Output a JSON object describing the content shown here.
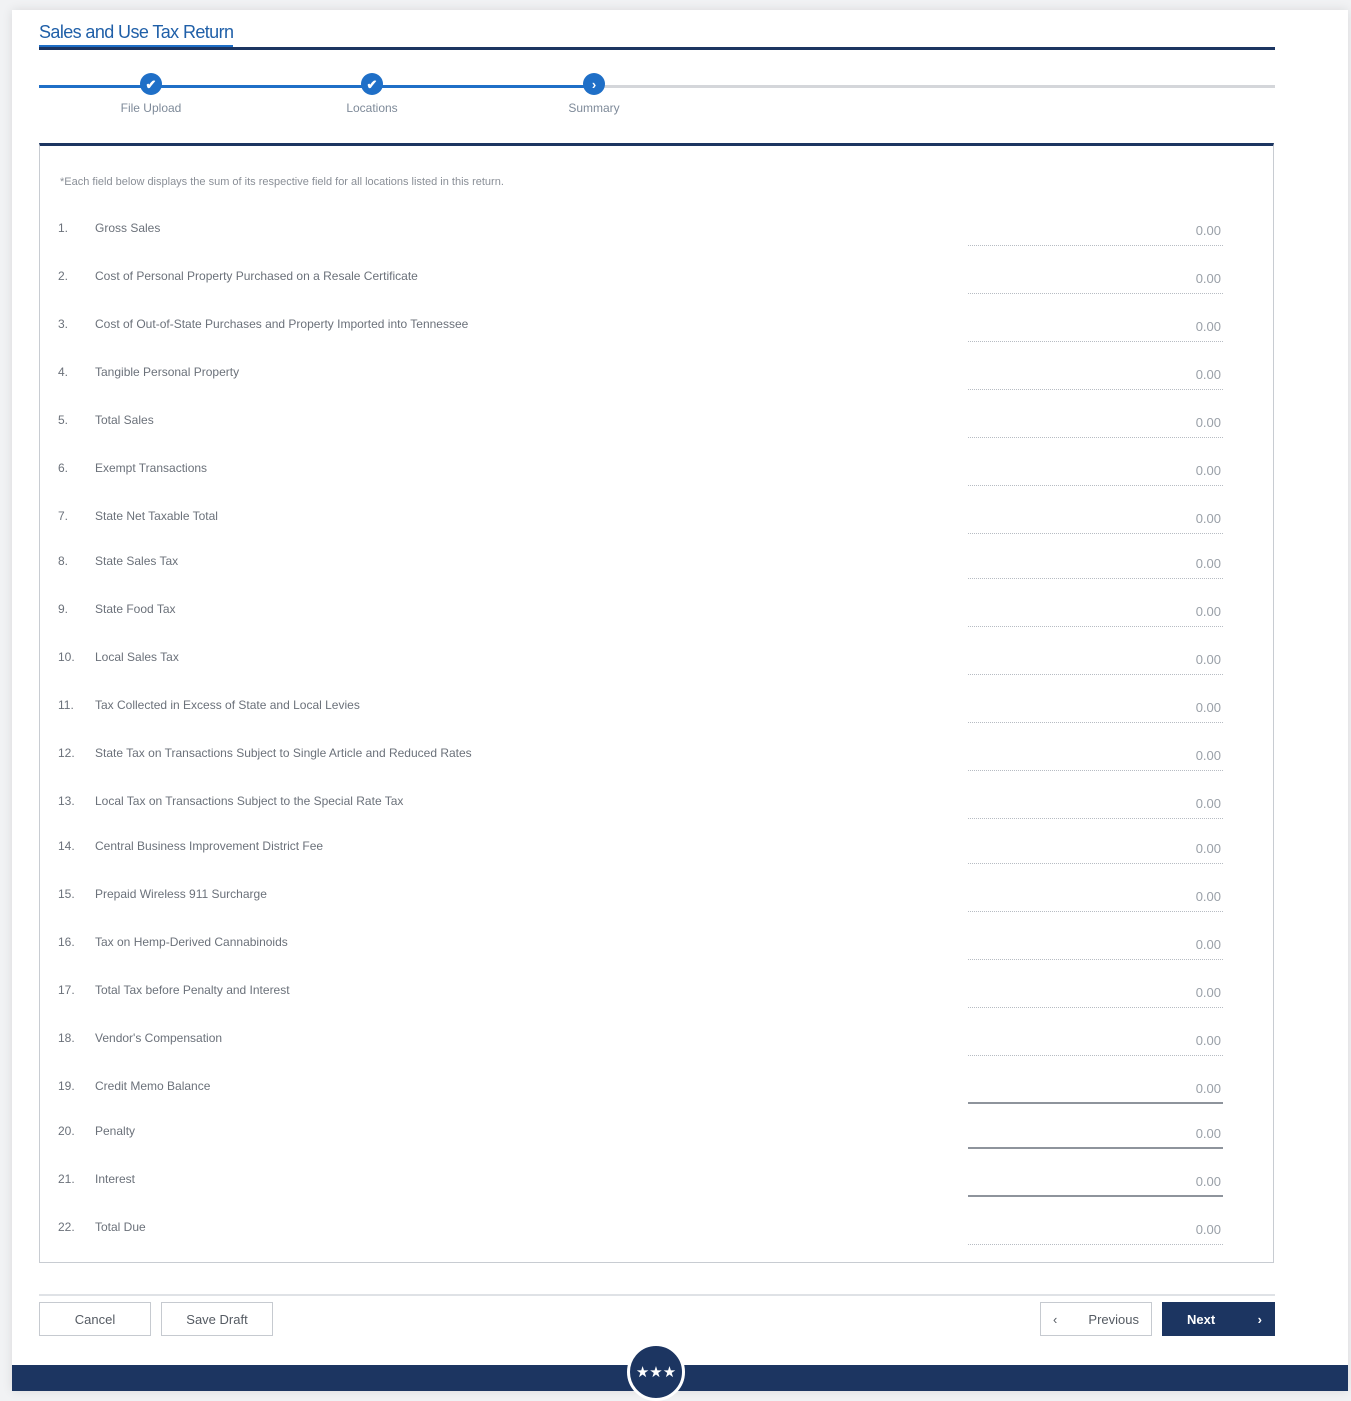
{
  "title": "Sales and Use Tax Return",
  "steps": [
    {
      "label": "File Upload",
      "icon": "✔"
    },
    {
      "label": "Locations",
      "icon": "✔"
    },
    {
      "label": "Summary",
      "icon": "›"
    }
  ],
  "note": "*Each field below displays the sum of its respective field for all locations listed in this return.",
  "lines": [
    {
      "num": "1.",
      "label": "Gross Sales",
      "value": "0.00"
    },
    {
      "num": "2.",
      "label": "Cost of Personal Property Purchased on a Resale Certificate",
      "value": "0.00"
    },
    {
      "num": "3.",
      "label": "Cost of Out-of-State Purchases and Property Imported into Tennessee",
      "value": "0.00"
    },
    {
      "num": "4.",
      "label": "Tangible Personal Property",
      "value": "0.00"
    },
    {
      "num": "5.",
      "label": "Total Sales",
      "value": "0.00"
    },
    {
      "num": "6.",
      "label": "Exempt Transactions",
      "value": "0.00"
    },
    {
      "num": "7.",
      "label": "State Net Taxable Total",
      "value": "0.00"
    },
    {
      "num": "8.",
      "label": "State Sales Tax",
      "value": "0.00"
    },
    {
      "num": "9.",
      "label": "State Food Tax",
      "value": "0.00"
    },
    {
      "num": "10.",
      "label": "Local Sales Tax",
      "value": "0.00"
    },
    {
      "num": "11.",
      "label": "Tax Collected in Excess of State and Local Levies",
      "value": "0.00"
    },
    {
      "num": "12.",
      "label": "State Tax on Transactions Subject to Single Article and Reduced Rates",
      "value": "0.00"
    },
    {
      "num": "13.",
      "label": "Local Tax on Transactions Subject to the Special Rate Tax",
      "value": "0.00"
    },
    {
      "num": "14.",
      "label": "Central Business Improvement District Fee",
      "value": "0.00"
    },
    {
      "num": "15.",
      "label": "Prepaid Wireless 911 Surcharge",
      "value": "0.00"
    },
    {
      "num": "16.",
      "label": "Tax on Hemp-Derived Cannabinoids",
      "value": "0.00"
    },
    {
      "num": "17.",
      "label": "Total Tax before Penalty and Interest",
      "value": "0.00"
    },
    {
      "num": "18.",
      "label": "Vendor's Compensation",
      "value": "0.00"
    },
    {
      "num": "19.",
      "label": "Credit Memo Balance",
      "value": "0.00"
    },
    {
      "num": "20.",
      "label": "Penalty",
      "value": "0.00"
    },
    {
      "num": "21.",
      "label": "Interest",
      "value": "0.00"
    },
    {
      "num": "22.",
      "label": "Total Due",
      "value": "0.00"
    }
  ],
  "buttons": {
    "cancel": "Cancel",
    "save_draft": "Save Draft",
    "previous": "Previous",
    "previous_icon": "‹",
    "next": "Next",
    "next_icon": "›"
  },
  "seal_icon": "tennessee-tristar-seal",
  "seal_glyph": "★★★",
  "colors": {
    "primary": "#1f6fc7",
    "navy": "#1c3561"
  }
}
